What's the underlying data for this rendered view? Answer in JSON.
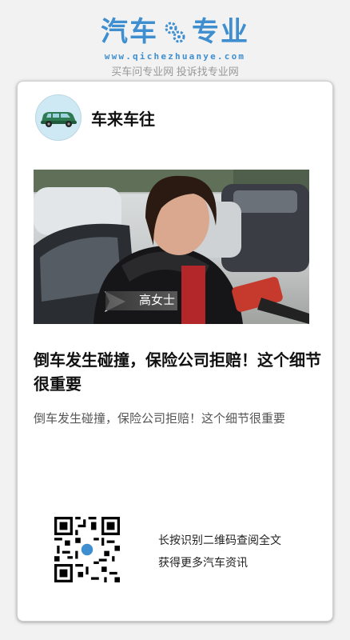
{
  "brand": {
    "word_left": "汽车",
    "word_right": "专业",
    "url": "www.qichezhuanye.com",
    "slogan": "买车问专业网 投诉找专业网",
    "color": "#3f8fd0"
  },
  "source": {
    "avatar_icon": "car-icon",
    "name": "车来车往"
  },
  "article": {
    "image_caption": "高女士",
    "title": "倒车发生碰撞，保险公司拒赔！这个细节很重要",
    "summary": "倒车发生碰撞，保险公司拒赔！这个细节很重要"
  },
  "qr": {
    "line1": "长按识别二维码查阅全文",
    "line2": "获得更多汽车资讯"
  }
}
